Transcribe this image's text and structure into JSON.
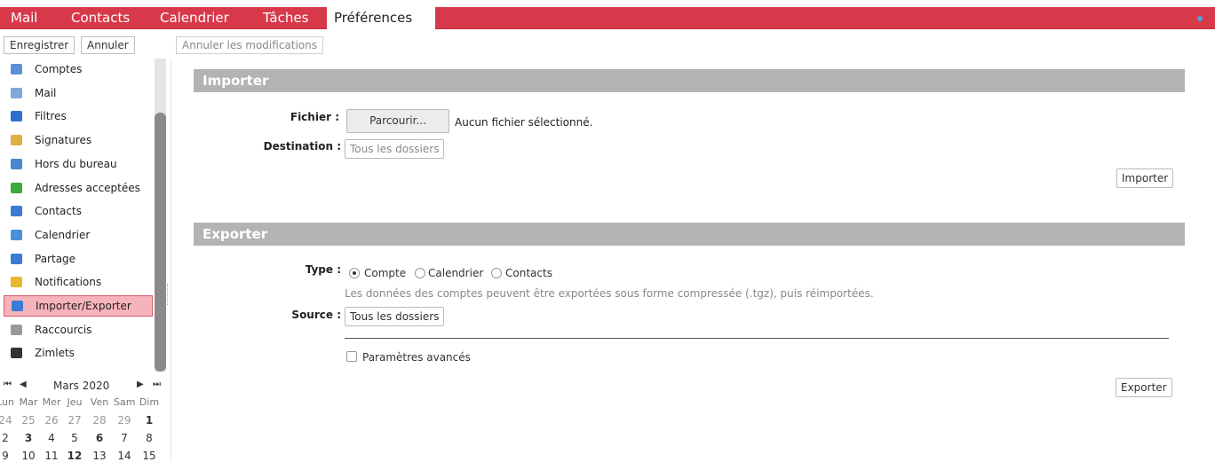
{
  "app_tabs": [
    {
      "label": "Mail"
    },
    {
      "label": "Contacts"
    },
    {
      "label": "Calendrier"
    },
    {
      "label": "Tâches"
    },
    {
      "label": "Préférences"
    }
  ],
  "toolbar": {
    "save_label": "Enregistrer",
    "cancel_label": "Annuler",
    "undo_label": "Annuler les modifications"
  },
  "sidebar": {
    "selected_index": 10,
    "items": [
      {
        "label": "Comptes",
        "icon": "accounts-icon",
        "color": "#5b8fd4"
      },
      {
        "label": "Mail",
        "icon": "mail-icon",
        "color": "#7fa9d8"
      },
      {
        "label": "Filtres",
        "icon": "filter-icon",
        "color": "#2d6fcf"
      },
      {
        "label": "Signatures",
        "icon": "signature-icon",
        "color": "#e0b040"
      },
      {
        "label": "Hors du bureau",
        "icon": "out-of-office-icon",
        "color": "#4a86cf"
      },
      {
        "label": "Adresses acceptées",
        "icon": "trusted-shield-icon",
        "color": "#3aaa3a"
      },
      {
        "label": "Contacts",
        "icon": "contacts-icon",
        "color": "#3a7bd5"
      },
      {
        "label": "Calendrier",
        "icon": "calendar-icon",
        "color": "#4a90d9"
      },
      {
        "label": "Partage",
        "icon": "sharing-icon",
        "color": "#3a7bd5"
      },
      {
        "label": "Notifications",
        "icon": "bell-icon",
        "color": "#e8b830"
      },
      {
        "label": "Importer/Exporter",
        "icon": "import-export-icon",
        "color": "#3a7bd5"
      },
      {
        "label": "Raccourcis",
        "icon": "keyboard-shortcut-icon",
        "color": "#999999"
      },
      {
        "label": "Zimlets",
        "icon": "zimlet-icon",
        "color": "#333333"
      }
    ]
  },
  "mini_calendar": {
    "month": "Mars 2020",
    "prev_year": "⏮",
    "prev_month": "◀",
    "next_month": "▶",
    "next_year": "⏭",
    "weekdays": [
      "Lun",
      "Mar",
      "Mer",
      "Jeu",
      "Ven",
      "Sam",
      "Dim"
    ],
    "weeks": [
      [
        {
          "d": "24",
          "o": true
        },
        {
          "d": "25",
          "o": true
        },
        {
          "d": "26",
          "o": true
        },
        {
          "d": "27",
          "o": true
        },
        {
          "d": "28",
          "o": true
        },
        {
          "d": "29",
          "o": true
        },
        {
          "d": "1",
          "b": true
        }
      ],
      [
        {
          "d": "2"
        },
        {
          "d": "3",
          "b": true
        },
        {
          "d": "4"
        },
        {
          "d": "5"
        },
        {
          "d": "6",
          "b": true
        },
        {
          "d": "7"
        },
        {
          "d": "8"
        }
      ],
      [
        {
          "d": "9"
        },
        {
          "d": "10"
        },
        {
          "d": "11"
        },
        {
          "d": "12",
          "b": true
        },
        {
          "d": "13"
        },
        {
          "d": "14"
        },
        {
          "d": "15"
        }
      ]
    ]
  },
  "import": {
    "title": "Importer",
    "file_label": "Fichier :",
    "browse_label": "Parcourir...",
    "no_file_text": "Aucun fichier sélectionné.",
    "destination_label": "Destination :",
    "destination_value": "Tous les dossiers",
    "submit_label": "Importer"
  },
  "export": {
    "title": "Exporter",
    "type_label": "Type :",
    "type_options": [
      "Compte",
      "Calendrier",
      "Contacts"
    ],
    "type_selected": "Compte",
    "hint": "Les données des comptes peuvent être exportées sous forme compressée (.tgz), puis réimportées.",
    "source_label": "Source :",
    "source_value": "Tous les dossiers",
    "advanced_label": "Paramètres avancés",
    "advanced_checked": false,
    "submit_label": "Exporter"
  }
}
